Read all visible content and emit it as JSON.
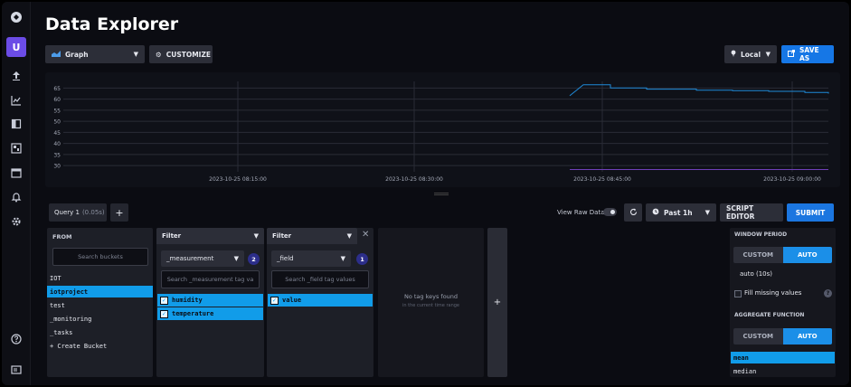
{
  "page": {
    "title": "Data Explorer"
  },
  "nav": {
    "avatar_letter": "U"
  },
  "toolbar": {
    "view_type": "Graph",
    "customize_label": "CUSTOMIZE",
    "timezone": "Local",
    "save_as_label": "SAVE AS"
  },
  "graph": {
    "y_ticks": [
      "65",
      "60",
      "55",
      "50",
      "45",
      "40",
      "35",
      "30"
    ],
    "x_ticks": [
      "2023-10-25 08:15:00",
      "2023-10-25 08:30:00",
      "2023-10-25 08:45:00",
      "2023-10-25 09:00:00"
    ],
    "line_color": "#1f8ad8",
    "accent_color": "#6f3fb8"
  },
  "chart_data": {
    "type": "line",
    "x": [
      "08:47",
      "08:48",
      "08:50",
      "08:55",
      "08:58",
      "09:00",
      "09:03",
      "09:05"
    ],
    "series": [
      {
        "values": [
          66.5,
          65.0,
          64.5,
          64.0,
          63.8,
          63.5,
          63.0,
          62.5
        ]
      }
    ],
    "ylim": [
      28,
      68
    ]
  },
  "query": {
    "tab_label": "Query 1",
    "tab_time": "(0.05s)",
    "add_label": "+",
    "view_raw_label": "View Raw Data",
    "time_range": "Past 1h",
    "script_editor_label": "SCRIPT EDITOR",
    "submit_label": "SUBMIT"
  },
  "from": {
    "header": "FROM",
    "search_placeholder": "Search buckets",
    "buckets": [
      "IOT",
      "iotproject",
      "test",
      "_monitoring",
      "_tasks",
      "+ Create Bucket"
    ]
  },
  "filter1": {
    "header": "Filter",
    "key": "_measurement",
    "count": "2",
    "search_placeholder": "Search _measurement tag va",
    "values": [
      "humidity",
      "temperature"
    ]
  },
  "filter2": {
    "header": "Filter",
    "key": "_field",
    "count": "1",
    "search_placeholder": "Search _field tag values",
    "values": [
      "value"
    ]
  },
  "empty_panel": {
    "title": "No tag keys found",
    "subtitle": "in the current time range",
    "add_label": "+"
  },
  "window": {
    "header": "WINDOW PERIOD",
    "custom_label": "CUSTOM",
    "auto_label": "AUTO",
    "auto_value": "auto (10s)",
    "fill_missing_label": "Fill missing values",
    "aggregate_header": "AGGREGATE FUNCTION",
    "functions": [
      "mean",
      "median"
    ]
  }
}
